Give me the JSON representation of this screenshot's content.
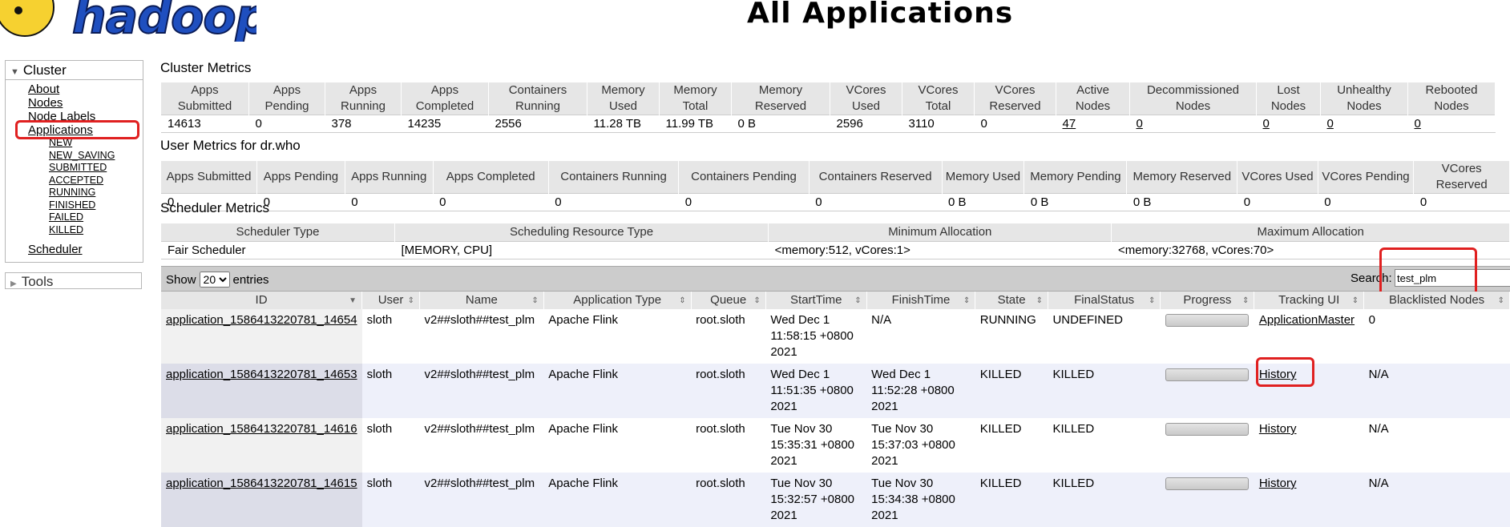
{
  "header": {
    "title": "All Applications",
    "logo_text": "hadoop"
  },
  "sidebar": {
    "cluster_label": "Cluster",
    "items": [
      "About",
      "Nodes",
      "Node Labels",
      "Applications"
    ],
    "app_states": [
      "NEW",
      "NEW_SAVING",
      "SUBMITTED",
      "ACCEPTED",
      "RUNNING",
      "FINISHED",
      "FAILED",
      "KILLED"
    ],
    "scheduler_label": "Scheduler",
    "tools_label": "Tools"
  },
  "cluster_metrics": {
    "title": "Cluster Metrics",
    "headers": [
      [
        "Apps",
        "Submitted"
      ],
      [
        "Apps",
        "Pending"
      ],
      [
        "Apps",
        "Running"
      ],
      [
        "Apps",
        "Completed"
      ],
      [
        "Containers",
        "Running"
      ],
      [
        "Memory",
        "Used"
      ],
      [
        "Memory",
        "Total"
      ],
      [
        "Memory",
        "Reserved"
      ],
      [
        "VCores",
        "Used"
      ],
      [
        "VCores",
        "Total"
      ],
      [
        "VCores",
        "Reserved"
      ],
      [
        "Active",
        "Nodes"
      ],
      [
        "Decommissioned",
        "Nodes"
      ],
      [
        "Lost",
        "Nodes"
      ],
      [
        "Unhealthy",
        "Nodes"
      ],
      [
        "Rebooted",
        "Nodes"
      ]
    ],
    "values": [
      "14613",
      "0",
      "378",
      "14235",
      "2556",
      "11.28 TB",
      "11.99 TB",
      "0 B",
      "2596",
      "3110",
      "0",
      "47",
      "0",
      "0",
      "0",
      "0"
    ]
  },
  "user_metrics": {
    "title": "User Metrics for dr.who",
    "headers": [
      "Apps Submitted",
      "Apps Pending",
      "Apps Running",
      "Apps Completed",
      "Containers Running",
      "Containers Pending",
      "Containers Reserved",
      "Memory Used",
      "Memory Pending",
      "Memory Reserved",
      "VCores Used",
      "VCores Pending",
      "VCores Reserved"
    ],
    "values": [
      "0",
      "0",
      "0",
      "0",
      "0",
      "0",
      "0",
      "0 B",
      "0 B",
      "0 B",
      "0",
      "0",
      "0"
    ]
  },
  "scheduler_metrics": {
    "title": "Scheduler Metrics",
    "headers": [
      "Scheduler Type",
      "Scheduling Resource Type",
      "Minimum Allocation",
      "Maximum Allocation"
    ],
    "values": [
      "Fair Scheduler",
      "[MEMORY, CPU]",
      "<memory:512, vCores:1>",
      "<memory:32768, vCores:70>"
    ]
  },
  "table_controls": {
    "show_label": "Show",
    "entries_value": "20",
    "entries_label": "entries",
    "search_label": "Search:",
    "search_value": "test_plm"
  },
  "apps_table": {
    "headers": [
      "ID",
      "User",
      "Name",
      "Application Type",
      "Queue",
      "StartTime",
      "FinishTime",
      "State",
      "FinalStatus",
      "Progress",
      "Tracking UI",
      "Blacklisted Nodes"
    ],
    "rows": [
      {
        "id": "application_1586413220781_14654",
        "user": "sloth",
        "name": "v2##sloth##test_plm",
        "type": "Apache Flink",
        "queue": "root.sloth",
        "start": [
          "Wed Dec 1",
          "11:58:15 +0800",
          "2021"
        ],
        "finish": [
          "N/A"
        ],
        "state": "RUNNING",
        "final": "UNDEFINED",
        "progress": 0,
        "tracking": "ApplicationMaster",
        "blacklisted": "0"
      },
      {
        "id": "application_1586413220781_14653",
        "user": "sloth",
        "name": "v2##sloth##test_plm",
        "type": "Apache Flink",
        "queue": "root.sloth",
        "start": [
          "Wed Dec 1",
          "11:51:35 +0800",
          "2021"
        ],
        "finish": [
          "Wed Dec 1",
          "11:52:28 +0800",
          "2021"
        ],
        "state": "KILLED",
        "final": "KILLED",
        "progress": 0,
        "tracking": "History",
        "blacklisted": "N/A"
      },
      {
        "id": "application_1586413220781_14616",
        "user": "sloth",
        "name": "v2##sloth##test_plm",
        "type": "Apache Flink",
        "queue": "root.sloth",
        "start": [
          "Tue Nov 30",
          "15:35:31 +0800",
          "2021"
        ],
        "finish": [
          "Tue Nov 30",
          "15:37:03 +0800",
          "2021"
        ],
        "state": "KILLED",
        "final": "KILLED",
        "progress": 0,
        "tracking": "History",
        "blacklisted": "N/A"
      },
      {
        "id": "application_1586413220781_14615",
        "user": "sloth",
        "name": "v2##sloth##test_plm",
        "type": "Apache Flink",
        "queue": "root.sloth",
        "start": [
          "Tue Nov 30",
          "15:32:57 +0800",
          "2021"
        ],
        "finish": [
          "Tue Nov 30",
          "15:34:38 +0800",
          "2021"
        ],
        "state": "KILLED",
        "final": "KILLED",
        "progress": 0,
        "tracking": "History",
        "blacklisted": "N/A"
      }
    ]
  },
  "colors": {
    "highlight": "#e02020",
    "header_bg": "#e6e6e6",
    "even_row": "#eef0fa"
  }
}
